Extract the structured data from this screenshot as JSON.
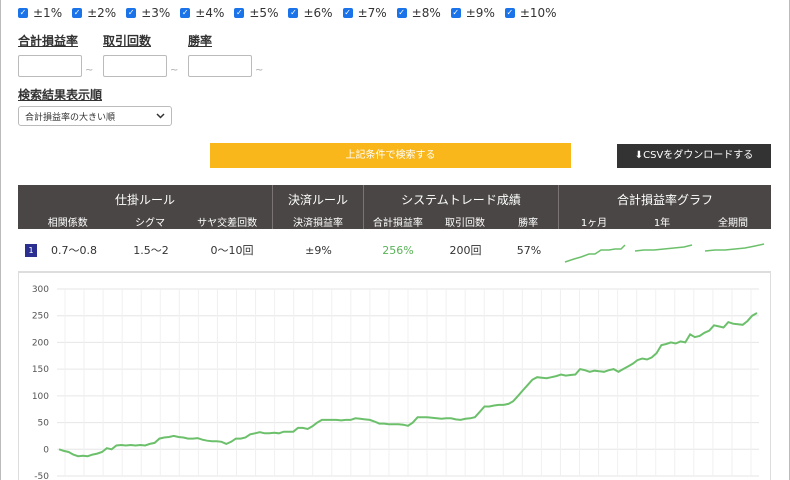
{
  "range_checkboxes": [
    "±1%",
    "±2%",
    "±3%",
    "±4%",
    "±5%",
    "±6%",
    "±7%",
    "±8%",
    "±9%",
    "±10%"
  ],
  "filters": {
    "labels": [
      "合計損益率",
      "取引回数",
      "勝率"
    ],
    "separator": "~"
  },
  "sort": {
    "label": "検索結果表示順",
    "selected": "合計損益率の大きい順"
  },
  "buttons": {
    "search": "上記条件で検索する",
    "csv": "CSVをダウンロードする"
  },
  "table": {
    "groups": [
      {
        "title": "仕掛ルール",
        "subs": [
          "相関係数",
          "シグマ",
          "サヤ交差回数"
        ]
      },
      {
        "title": "決済ルール",
        "subs": [
          "決済損益率"
        ]
      },
      {
        "title": "システムトレード成績",
        "subs": [
          "合計損益率",
          "取引回数",
          "勝率"
        ]
      },
      {
        "title": "合計損益率グラフ",
        "subs": [
          "1ヶ月",
          "1年",
          "全期間"
        ]
      }
    ],
    "row": {
      "rank": "1",
      "corr": "0.7～0.8",
      "sigma": "1.5～2",
      "crosses": "0～10回",
      "exit": "±9%",
      "profit": "256%",
      "trades": "200回",
      "winrate": "57%"
    }
  },
  "colors": {
    "accent": "#f9b71c",
    "line": "#6cc06b",
    "header": "#4b4646"
  },
  "chart_data": {
    "type": "line",
    "ylim": [
      -50,
      300
    ],
    "yticks": [
      300,
      250,
      200,
      150,
      100,
      50,
      0,
      -50
    ],
    "values": [
      0,
      -3,
      -5,
      -10,
      -13,
      -12,
      -13,
      -10,
      -8,
      -5,
      2,
      0,
      7,
      8,
      7,
      8,
      7,
      8,
      7,
      10,
      12,
      20,
      22,
      23,
      25,
      23,
      22,
      20,
      20,
      21,
      18,
      16,
      15,
      15,
      14,
      10,
      14,
      20,
      20,
      22,
      28,
      30,
      32,
      30,
      30,
      31,
      30,
      33,
      33,
      33,
      40,
      40,
      38,
      43,
      50,
      55,
      55,
      55,
      55,
      54,
      55,
      55,
      58,
      57,
      56,
      55,
      52,
      48,
      48,
      47,
      47,
      47,
      46,
      44,
      50,
      60,
      60,
      60,
      59,
      58,
      57,
      58,
      58,
      56,
      55,
      57,
      58,
      60,
      70,
      80,
      80,
      82,
      83,
      83,
      85,
      90,
      100,
      110,
      120,
      130,
      135,
      134,
      133,
      135,
      137,
      140,
      138,
      139,
      140,
      150,
      148,
      145,
      147,
      146,
      145,
      148,
      150,
      145,
      150,
      155,
      160,
      167,
      170,
      168,
      172,
      180,
      195,
      197,
      200,
      198,
      202,
      200,
      215,
      210,
      212,
      218,
      222,
      232,
      230,
      228,
      238,
      235,
      234,
      233,
      240,
      250,
      255
    ]
  }
}
